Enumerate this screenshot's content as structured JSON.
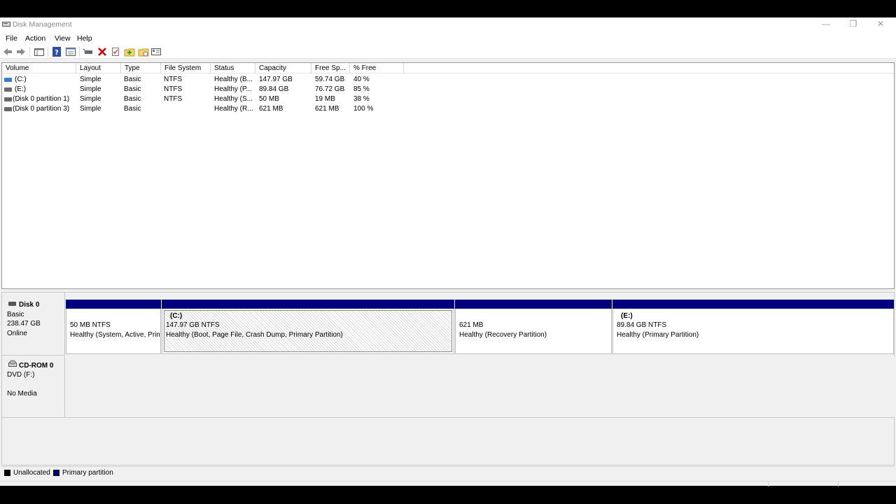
{
  "window": {
    "title": "Disk Management"
  },
  "menu": [
    "File",
    "Action",
    "View",
    "Help"
  ],
  "toolbar": {
    "icons": [
      "back-arrow-icon",
      "forward-arrow-icon",
      "list-view-icon",
      "help-icon",
      "properties-icon",
      "connect-icon",
      "delete-icon",
      "check-icon",
      "new-folder-icon",
      "open-folder-icon",
      "settings-view-icon"
    ]
  },
  "list": {
    "columns": [
      "Volume",
      "Layout",
      "Type",
      "File System",
      "Status",
      "Capacity",
      "Free Sp...",
      "% Free"
    ],
    "rows": [
      {
        "icon": "blue",
        "volume": "(C:)",
        "layout": "Simple",
        "type": "Basic",
        "fs": "NTFS",
        "status": "Healthy (B...",
        "capacity": "147.97 GB",
        "free": "59.74 GB",
        "pct": "40 %"
      },
      {
        "icon": "gray",
        "volume": "(E:)",
        "layout": "Simple",
        "type": "Basic",
        "fs": "NTFS",
        "status": "Healthy (P...",
        "capacity": "89.84 GB",
        "free": "76.72 GB",
        "pct": "85 %"
      },
      {
        "icon": "gray",
        "volume": "(Disk 0 partition 1)",
        "layout": "Simple",
        "type": "Basic",
        "fs": "NTFS",
        "status": "Healthy (S...",
        "capacity": "50 MB",
        "free": "19 MB",
        "pct": "38 %"
      },
      {
        "icon": "gray",
        "volume": "(Disk 0 partition 3)",
        "layout": "Simple",
        "type": "Basic",
        "fs": "",
        "status": "Healthy (R...",
        "capacity": "621 MB",
        "free": "621 MB",
        "pct": "100 %"
      }
    ]
  },
  "disks": {
    "disk0": {
      "name": "Disk 0",
      "kind": "Basic",
      "size": "238.47 GB",
      "state": "Online",
      "partitions": [
        {
          "label": "",
          "size": "50 MB NTFS",
          "status": "Healthy (System, Active, Primary Partition)"
        },
        {
          "label": "(C:)",
          "size": "147.97 GB NTFS",
          "status": "Healthy (Boot, Page File, Crash Dump, Primary Partition)"
        },
        {
          "label": "",
          "size": "621 MB",
          "status": "Healthy (Recovery Partition)"
        },
        {
          "label": "(E:)",
          "size": "89.84 GB NTFS",
          "status": "Healthy (Primary Partition)"
        }
      ]
    },
    "cdrom0": {
      "name": "CD-ROM 0",
      "kind": "DVD (F:)",
      "media": "No Media"
    }
  },
  "legend": [
    {
      "label": "Unallocated",
      "color": "#000000"
    },
    {
      "label": "Primary partition",
      "color": "#00007f"
    }
  ]
}
